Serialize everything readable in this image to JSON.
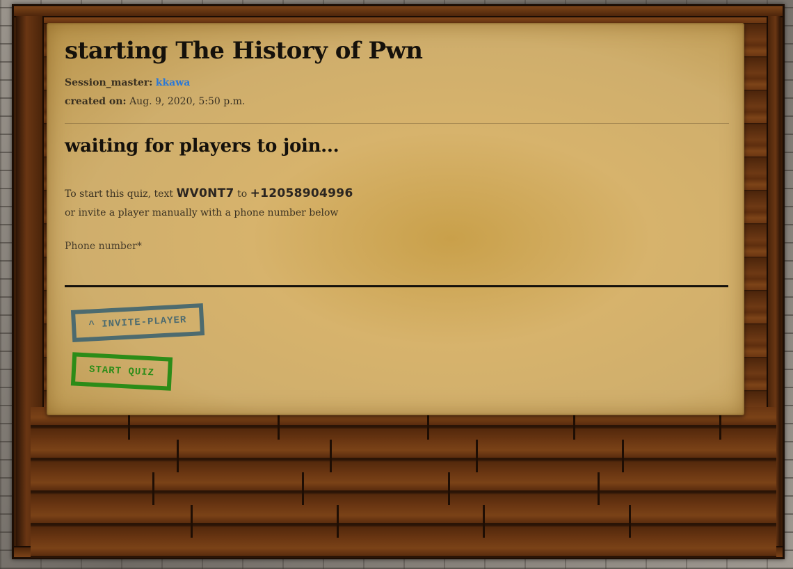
{
  "quiz": {
    "title": "starting The History of Pwn",
    "session_master_label": "Session_master:",
    "session_master_name": "kkawa",
    "created_label": "created on:",
    "created_value": "Aug. 9, 2020, 5:50 p.m."
  },
  "lobby": {
    "waiting_heading": "waiting for players to join...",
    "instruction_prefix": "To start this quiz, text",
    "join_code": "WV0NT7",
    "instruction_to": "to",
    "sms_number": "+12058904996",
    "instruction_line2": "or invite a player manually with a phone number below"
  },
  "invite_form": {
    "phone_label": "Phone number*",
    "phone_value": "",
    "invite_button_label": "^ INVITE-PLAYER",
    "start_button_label": "START QUIZ"
  },
  "colors": {
    "link": "#2a78d6",
    "invite_stamp": "#3f6470",
    "start_stamp": "#1f8a12",
    "parchment": "#d7b36c",
    "wood": "#6b3612"
  }
}
